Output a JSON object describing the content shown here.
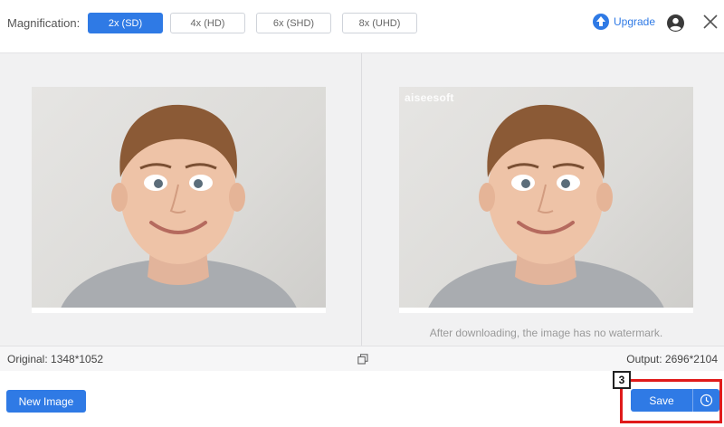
{
  "toolbar": {
    "magnification_label": "Magnification:",
    "options": [
      {
        "label": "2x (SD)",
        "active": true
      },
      {
        "label": "4x (HD)",
        "active": false
      },
      {
        "label": "6x (SHD)",
        "active": false
      },
      {
        "label": "8x (UHD)",
        "active": false
      }
    ],
    "upgrade_label": "Upgrade",
    "upgrade_icon": "upload-arrow-icon",
    "account_icon": "user-account-icon",
    "close_icon": "close-icon"
  },
  "preview": {
    "watermark_text": "aiseesoft",
    "note": "After downloading, the image has no watermark."
  },
  "info": {
    "original": "Original: 1348*1052",
    "output": "Output: 2696*2104"
  },
  "actions": {
    "new_image_label": "New Image",
    "save_label": "Save",
    "history_icon": "clock-icon",
    "step_number": "3"
  },
  "colors": {
    "accent": "#2f7ae5",
    "highlight": "#e01b1b"
  }
}
